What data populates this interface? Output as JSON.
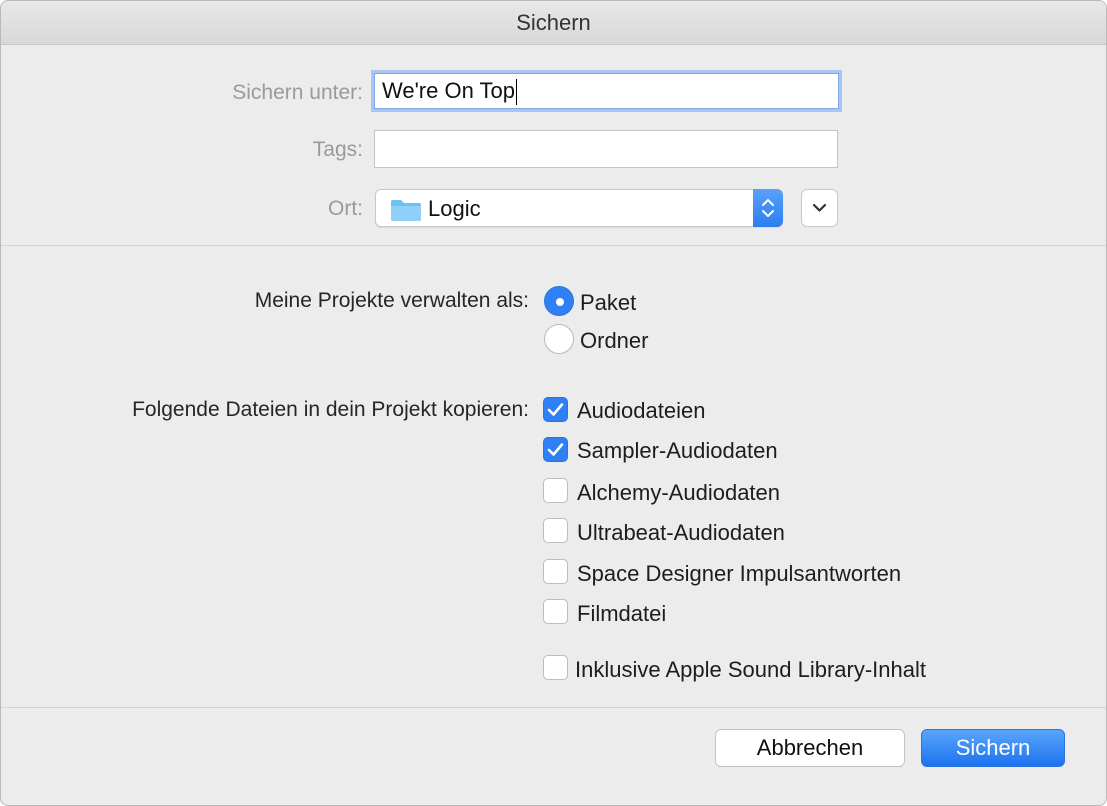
{
  "window": {
    "title": "Sichern"
  },
  "form": {
    "save_as_label": "Sichern unter:",
    "save_as_value": "We're On Top",
    "tags_label": "Tags:",
    "tags_value": "",
    "location_label": "Ort:",
    "location_value": "Logic",
    "folder_icon": "folder-icon",
    "expand_icon": "chevron-down-icon"
  },
  "manage": {
    "label": "Meine Projekte verwalten als:",
    "options": [
      {
        "label": "Paket",
        "selected": true
      },
      {
        "label": "Ordner",
        "selected": false
      }
    ]
  },
  "copy": {
    "label": "Folgende Dateien in dein Projekt kopieren:",
    "options": [
      {
        "label": "Audiodateien",
        "checked": true
      },
      {
        "label": "Sampler-Audiodaten",
        "checked": true
      },
      {
        "label": "Alchemy-Audiodaten",
        "checked": false
      },
      {
        "label": "Ultrabeat-Audiodaten",
        "checked": false
      },
      {
        "label": "Space Designer Impulsantworten",
        "checked": false
      },
      {
        "label": "Filmdatei",
        "checked": false
      }
    ],
    "library": {
      "label": "Inklusive Apple Sound Library-Inhalt",
      "checked": false
    }
  },
  "buttons": {
    "cancel": "Abbrechen",
    "save": "Sichern"
  },
  "colors": {
    "accent": "#2f7ff5",
    "window_bg": "#ececec",
    "focus_ring": "#a9c6f2"
  }
}
